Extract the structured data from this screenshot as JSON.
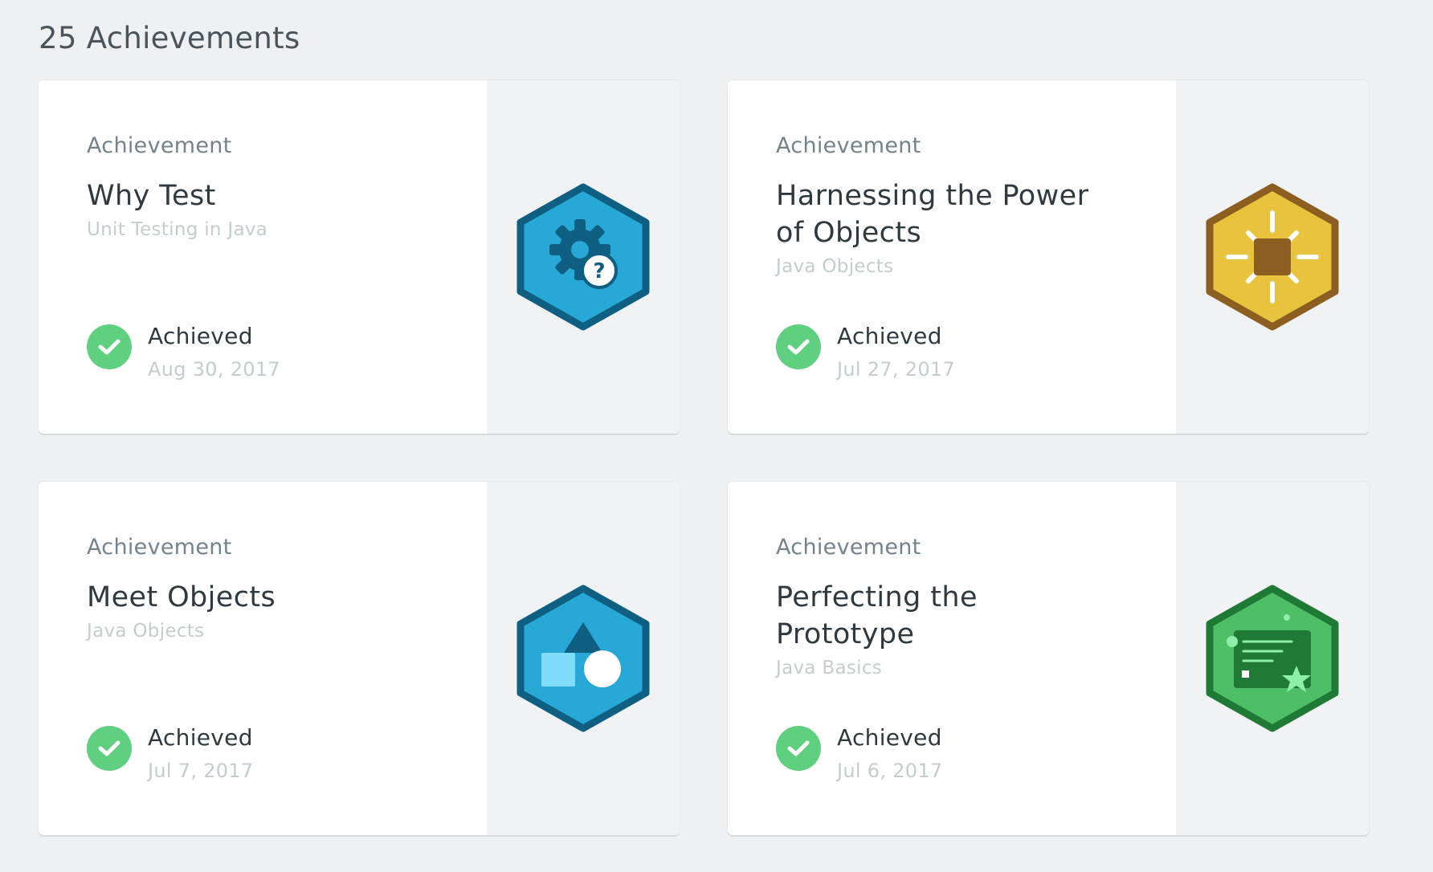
{
  "page": {
    "heading": "25 Achievements"
  },
  "cards": [
    {
      "kicker": "Achievement",
      "title": "Why Test",
      "course": "Unit Testing in Java",
      "status": "Achieved",
      "date": "Aug 30, 2017",
      "badge_icon": "gear-question-icon"
    },
    {
      "kicker": "Achievement",
      "title": "Harnessing the Power of Objects",
      "course": "Java Objects",
      "status": "Achieved",
      "date": "Jul 27, 2017",
      "badge_icon": "sunburst-icon"
    },
    {
      "kicker": "Achievement",
      "title": "Meet Objects",
      "course": "Java Objects",
      "status": "Achieved",
      "date": "Jul 7, 2017",
      "badge_icon": "shapes-icon"
    },
    {
      "kicker": "Achievement",
      "title": "Perfecting the Prototype",
      "course": "Java Basics",
      "status": "Achieved",
      "date": "Jul 6, 2017",
      "badge_icon": "prototype-card-icon"
    }
  ],
  "colors": {
    "check_green": "#5fcf80",
    "badge_blue": "#27a8d6",
    "badge_blue_border": "#0e5f81",
    "badge_gold": "#e9c33d",
    "badge_gold_border": "#8c5e1f",
    "badge_green": "#4fbf67",
    "badge_green_border": "#1e7a34"
  }
}
